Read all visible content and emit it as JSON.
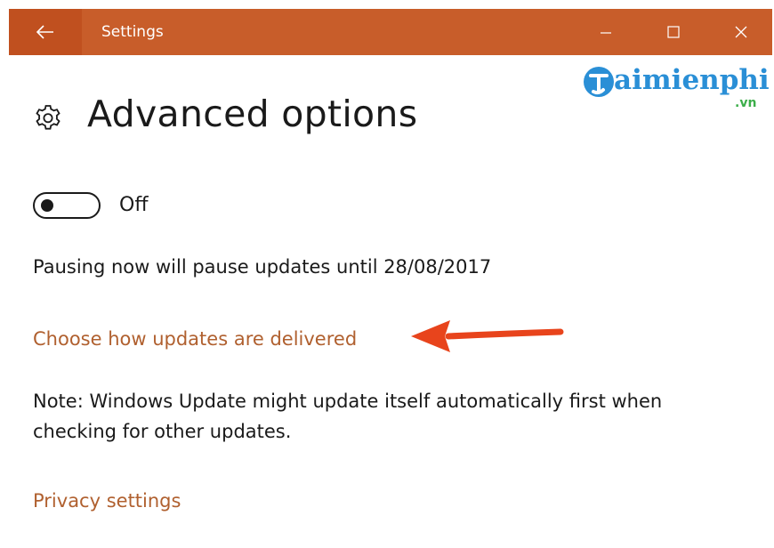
{
  "window": {
    "title": "Settings",
    "accent_color": "#c85d2a",
    "controls": [
      "minimize-icon",
      "maximize-icon",
      "close-icon"
    ]
  },
  "watermark": {
    "text": "aimienphi",
    "suffix": ".vn",
    "brand_color": "#2a8fd6"
  },
  "page": {
    "title": "Advanced options",
    "icon": "gear-icon"
  },
  "pause_toggle": {
    "state": "Off",
    "on": false
  },
  "pause_info": "Pausing now will pause updates until 28/08/2017",
  "links": {
    "delivery": "Choose how updates are delivered",
    "privacy": "Privacy settings",
    "color": "#b0602f"
  },
  "note": {
    "line1": "Note: Windows Update might update itself automatically first when",
    "line2": "checking for other updates."
  },
  "annotation": {
    "arrow_color": "#e8441c"
  }
}
